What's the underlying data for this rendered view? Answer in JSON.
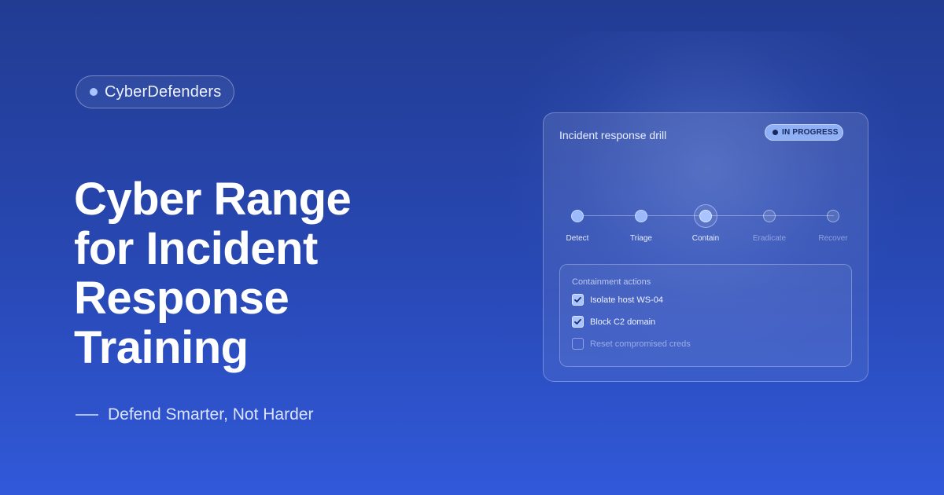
{
  "brand": {
    "name": "CyberDefenders"
  },
  "headline": {
    "lines": [
      "Cyber Range",
      "for Incident",
      "Response",
      "Training"
    ]
  },
  "tagline": "Defend Smarter, Not Harder",
  "card": {
    "title": "Incident response drill",
    "status": {
      "label": "IN PROGRESS",
      "color": "#8fb0f4"
    },
    "steps": [
      {
        "label": "Detect",
        "state": "done"
      },
      {
        "label": "Triage",
        "state": "done"
      },
      {
        "label": "Contain",
        "state": "current"
      },
      {
        "label": "Eradicate",
        "state": "pending"
      },
      {
        "label": "Recover",
        "state": "pending"
      }
    ],
    "actions": {
      "title": "Containment actions",
      "items": [
        {
          "label": "Isolate host WS-04",
          "checked": true
        },
        {
          "label": "Block C2 domain",
          "checked": true
        },
        {
          "label": "Reset compromised creds",
          "checked": false
        }
      ]
    }
  },
  "colors": {
    "background_top": "#223c92",
    "background_bottom": "#3159d9",
    "accent": "#a9c4ff"
  }
}
